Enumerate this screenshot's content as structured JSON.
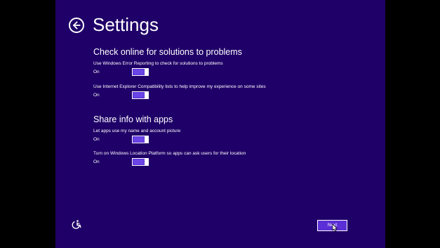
{
  "page": {
    "title": "Settings",
    "back_icon": "back-arrow-icon"
  },
  "sections": [
    {
      "title": "Check online for solutions to problems",
      "settings": [
        {
          "label": "Use Windows Error Reporting to check for solutions to problems",
          "state": "On",
          "on": true
        },
        {
          "label": "Use Internet Explorer Compatibility lists to help improve my experience on some sites",
          "state": "On",
          "on": true
        }
      ]
    },
    {
      "title": "Share info with apps",
      "settings": [
        {
          "label": "Let apps use my name and account picture",
          "state": "On",
          "on": true
        },
        {
          "label": "Turn on Windows Location Platform so apps can ask users for their location",
          "state": "On",
          "on": true
        }
      ]
    }
  ],
  "footer": {
    "ease_of_access_icon": "ease-of-access-icon",
    "next_label": "Next",
    "pointer_icon": "mouse-pointer-icon"
  },
  "colors": {
    "background": "#1f0068",
    "accent": "#5b2fd6",
    "letterbox": "#000000",
    "text": "#ffffff"
  }
}
